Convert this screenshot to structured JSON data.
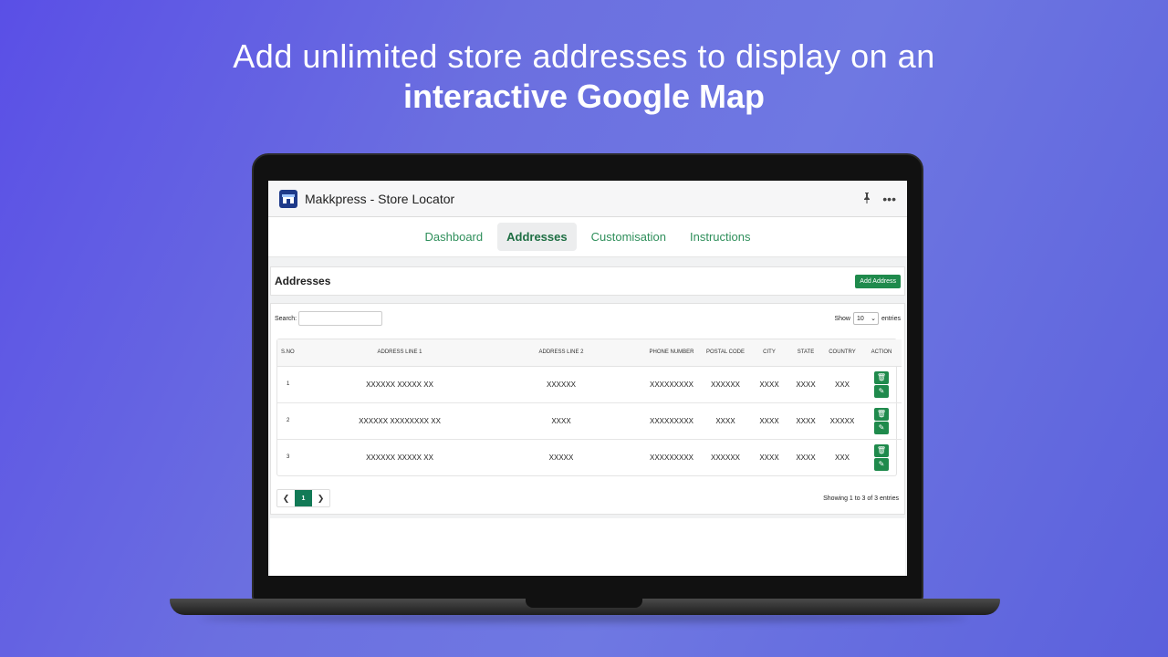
{
  "headline": {
    "line1": "Add unlimited store addresses to display on an",
    "line2": "interactive Google Map"
  },
  "app": {
    "title": "Makkpress - Store Locator",
    "pin_icon": "📌",
    "more_icon": "•••"
  },
  "tabs": [
    "Dashboard",
    "Addresses",
    "Customisation",
    "Instructions"
  ],
  "active_tab": "Addresses",
  "addresses_panel": {
    "title": "Addresses",
    "add_button": "Add Address"
  },
  "controls": {
    "search_label": "Search:",
    "search_value": "",
    "show_label": "Show",
    "show_value": "10",
    "entries_label": "entries"
  },
  "table": {
    "headers": [
      "S.NO",
      "ADDRESS LINE 1",
      "ADDRESS LINE 2",
      "PHONE NUMBER",
      "POSTAL CODE",
      "CITY",
      "STATE",
      "COUNTRY",
      "ACTION"
    ],
    "rows": [
      [
        "1",
        "XXXXXX XXXXX XX",
        "XXXXXX",
        "XXXXXXXXX",
        "XXXXXX",
        "XXXX",
        "XXXX",
        "XXX"
      ],
      [
        "2",
        "XXXXXX XXXXXXXX XX",
        "XXXX",
        "XXXXXXXXX",
        "XXXX",
        "XXXX",
        "XXXX",
        "XXXXX"
      ],
      [
        "3",
        "XXXXXX XXXXX XX",
        "XXXXX",
        "XXXXXXXXX",
        "XXXXXX",
        "XXXX",
        "XXXX",
        "XXX"
      ]
    ]
  },
  "pagination": {
    "prev": "❮",
    "current": "1",
    "next": "❯",
    "showing": "Showing 1 to 3 of 3 entries"
  },
  "colors": {
    "accent": "#1f8a4c",
    "background_start": "#5a4fe6",
    "background_end": "#6f78e2"
  }
}
